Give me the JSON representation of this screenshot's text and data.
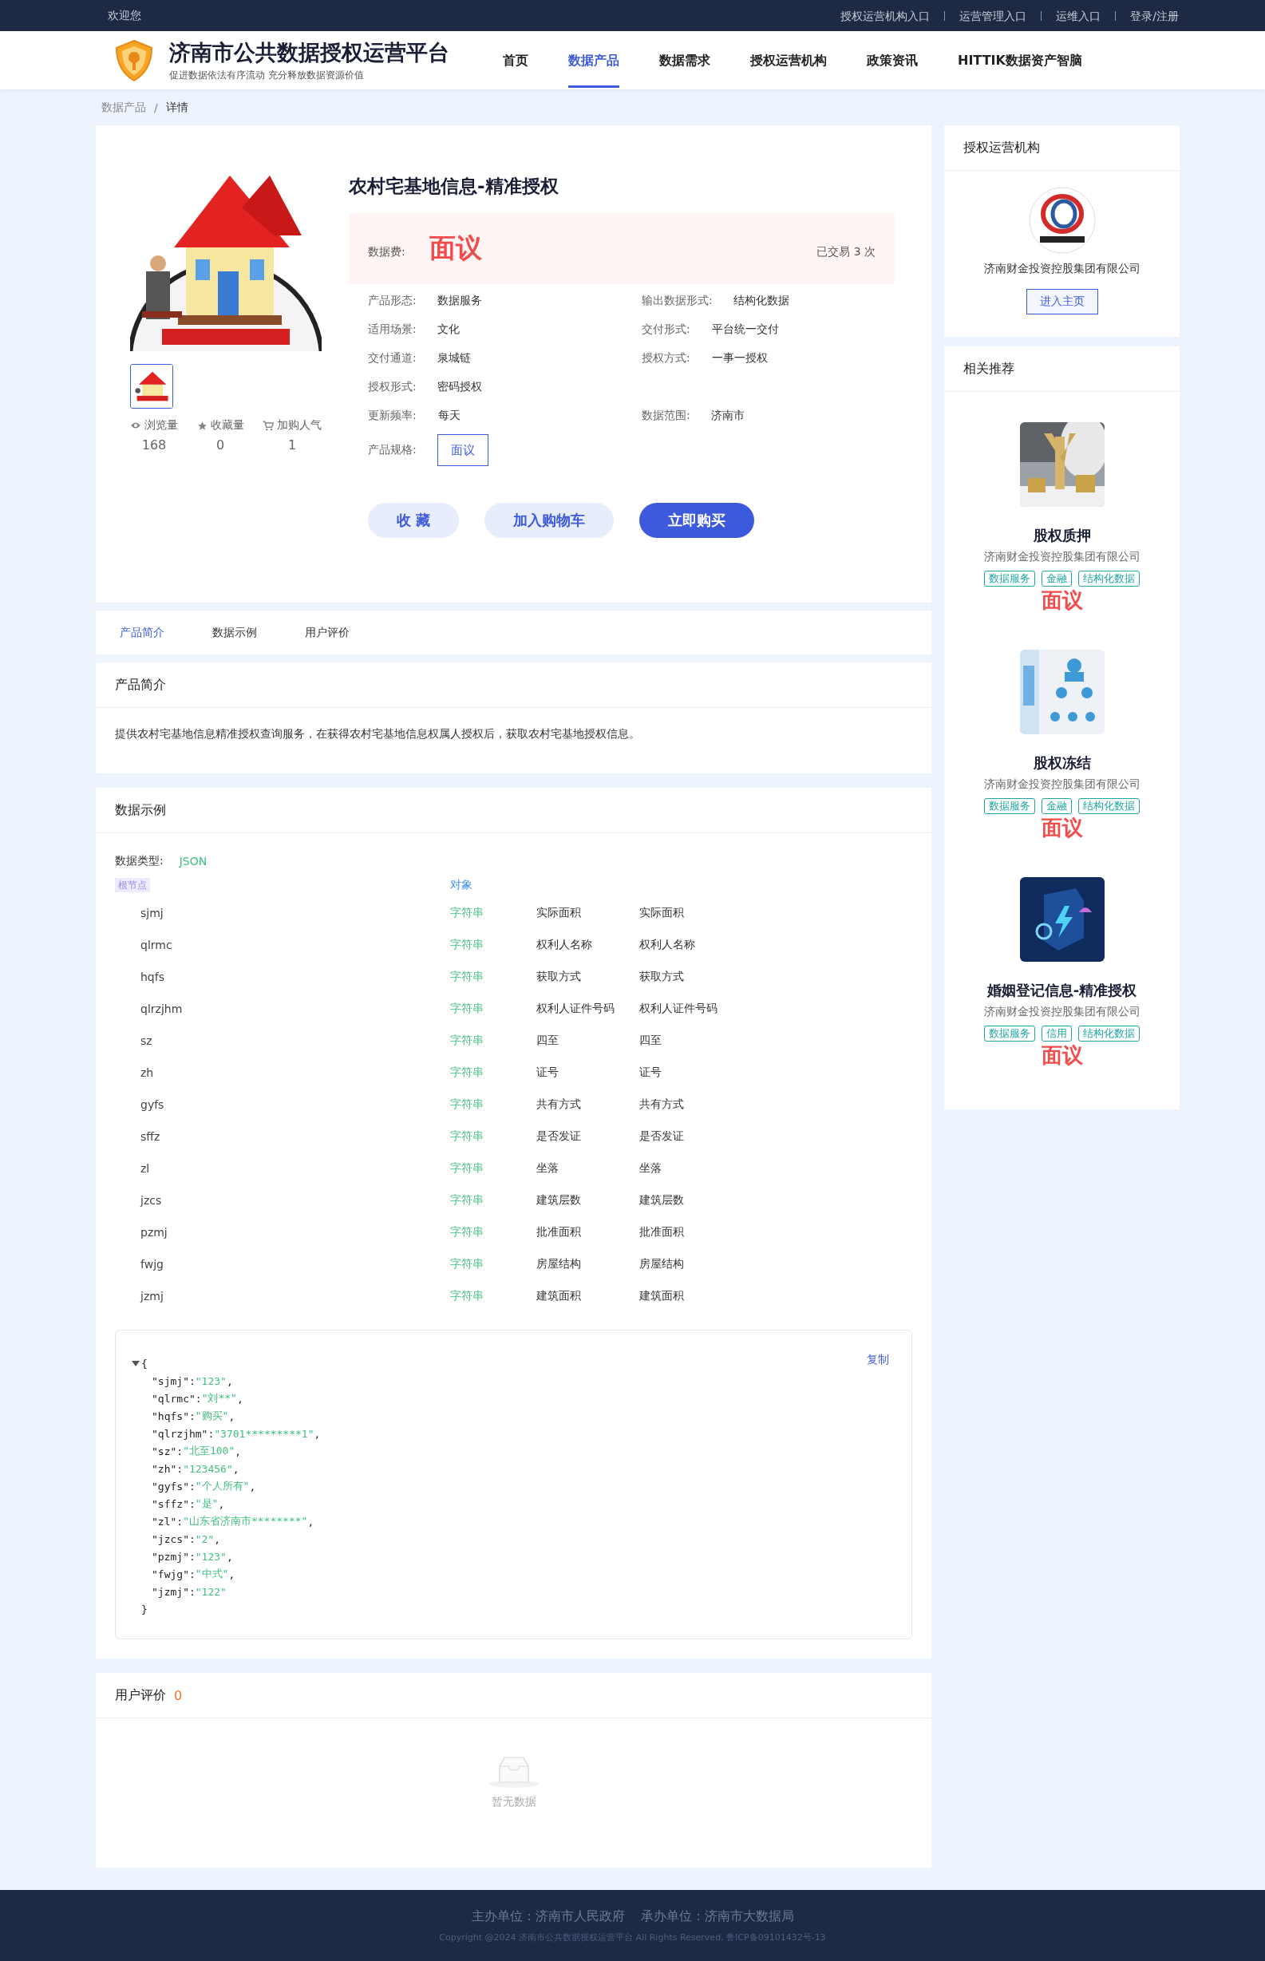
{
  "top_bar": {
    "welcome": "欢迎您",
    "links": [
      "授权运营机构入口",
      "运营管理入口",
      "运维入口",
      "登录/注册"
    ]
  },
  "header": {
    "site_title": "济南市公共数据授权运营平台",
    "slogan": "促进数据依法有序流动 充分释放数据资源价值",
    "nav": [
      {
        "label": "首页",
        "selected": false
      },
      {
        "label": "数据产品",
        "selected": true
      },
      {
        "label": "数据需求",
        "selected": false
      },
      {
        "label": "授权运营机构",
        "selected": false
      },
      {
        "label": "政策资讯",
        "selected": false
      },
      {
        "label": "HITTIK数据资产智脑",
        "selected": false
      }
    ]
  },
  "breadcrumb": [
    "数据产品",
    "/",
    "详情"
  ],
  "product": {
    "title": "农村宅基地信息-精准授权",
    "fee_label": "数据费:",
    "price": "面议",
    "trades": "已交易 3 次",
    "stats": [
      {
        "kind": "views",
        "label": "浏览量",
        "value": "168"
      },
      {
        "kind": "favorites",
        "label": "收藏量",
        "value": "0"
      },
      {
        "kind": "cart",
        "label": "加购人气",
        "value": "1"
      }
    ],
    "attributes": [
      {
        "label": "产品形态:",
        "value": "数据服务"
      },
      {
        "label": "输出数据形式:",
        "value": "结构化数据"
      },
      {
        "label": "适用场景:",
        "value": "文化"
      },
      {
        "label": "交付形式:",
        "value": "平台统一交付"
      },
      {
        "label": "交付通道:",
        "value": "泉城链"
      },
      {
        "label": "授权方式:",
        "value": "一事一授权"
      },
      {
        "label": "授权形式:",
        "value": "密码授权"
      },
      {
        "label": "更新频率:",
        "value": "每天"
      },
      {
        "label": "数据范围:",
        "value": "济南市"
      }
    ],
    "spec_label": "产品规格:",
    "spec": "面议",
    "buttons": [
      {
        "kind": "light",
        "label": "收 藏"
      },
      {
        "kind": "light",
        "label": "加入购物车"
      },
      {
        "kind": "primary",
        "label": "立即购买"
      }
    ]
  },
  "tabs": [
    {
      "label": "产品简介",
      "selected": true
    },
    {
      "label": "数据示例",
      "selected": false
    },
    {
      "label": "用户评价",
      "selected": false
    }
  ],
  "intro": {
    "title": "产品简介",
    "text": "提供农村宅基地信息精准授权查询服务，在获得农村宅基地信息权属人授权后，获取农村宅基地授权信息。"
  },
  "data_example": {
    "title": "数据示例",
    "type_label": "数据类型:",
    "type": "JSON",
    "root_tag": "根节点",
    "root_type": "对象",
    "fields": [
      {
        "name": "sjmj",
        "type": "字符串",
        "column_3": "实际面积",
        "column_4": "实际面积"
      },
      {
        "name": "qlrmc",
        "type": "字符串",
        "column_3": "权利人名称",
        "column_4": "权利人名称"
      },
      {
        "name": "hqfs",
        "type": "字符串",
        "column_3": "获取方式",
        "column_4": "获取方式"
      },
      {
        "name": "qlrzjhm",
        "type": "字符串",
        "column_3": "权利人证件号码",
        "column_4": "权利人证件号码"
      },
      {
        "name": "sz",
        "type": "字符串",
        "column_3": "四至",
        "column_4": "四至"
      },
      {
        "name": "zh",
        "type": "字符串",
        "column_3": "证号",
        "column_4": "证号"
      },
      {
        "name": "gyfs",
        "type": "字符串",
        "column_3": "共有方式",
        "column_4": "共有方式"
      },
      {
        "name": "sffz",
        "type": "字符串",
        "column_3": "是否发证",
        "column_4": "是否发证"
      },
      {
        "name": "zl",
        "type": "字符串",
        "column_3": "坐落",
        "column_4": "坐落"
      },
      {
        "name": "jzcs",
        "type": "字符串",
        "column_3": "建筑层数",
        "column_4": "建筑层数"
      },
      {
        "name": "pzmj",
        "type": "字符串",
        "column_3": "批准面积",
        "column_4": "批准面积"
      },
      {
        "name": "fwjg",
        "type": "字符串",
        "column_3": "房屋结构",
        "column_4": "房屋结构"
      },
      {
        "name": "jzmj",
        "type": "字符串",
        "column_3": "建筑面积",
        "column_4": "建筑面积"
      }
    ],
    "code": {
      "copy": "复制",
      "open": "{",
      "close": "}",
      "expanded": true,
      "lines": [
        {
          "key": "\"sjmj\":",
          "value": "\"123\"",
          "tail": ","
        },
        {
          "key": "\"qlrmc\":",
          "value": "\"刘**\"",
          "tail": ","
        },
        {
          "key": "\"hqfs\":",
          "value": "\"购买\"",
          "tail": ","
        },
        {
          "key": "\"qlrzjhm\":",
          "value": "\"3701*********1\"",
          "tail": ","
        },
        {
          "key": "\"sz\":",
          "value": "\"北至100\"",
          "tail": ","
        },
        {
          "key": "\"zh\":",
          "value": "\"123456\"",
          "tail": ","
        },
        {
          "key": "\"gyfs\":",
          "value": "\"个人所有\"",
          "tail": ","
        },
        {
          "key": "\"sffz\":",
          "value": "\"是\"",
          "tail": ","
        },
        {
          "key": "\"zl\":",
          "value": "\"山东省济南市********\"",
          "tail": ","
        },
        {
          "key": "\"jzcs\":",
          "value": "\"2\"",
          "tail": ","
        },
        {
          "key": "\"pzmj\":",
          "value": "\"123\"",
          "tail": ","
        },
        {
          "key": "\"fwjg\":",
          "value": "\"中式\"",
          "tail": ","
        },
        {
          "key": "\"jzmj\":",
          "value": "\"122\""
        }
      ]
    }
  },
  "reviews": {
    "title": "用户评价",
    "count": "0",
    "empty": "暂无数据"
  },
  "org": {
    "title": "授权运营机构",
    "name": "济南财金投资控股集团有限公司",
    "button": "进入主页"
  },
  "recommended": {
    "title": "相关推荐",
    "items": [
      {
        "kind": "coins",
        "name": "股权质押",
        "company": "济南财金投资控股集团有限公司",
        "tags": [
          "数据服务",
          "金融",
          "结构化数据"
        ],
        "price": "面议"
      },
      {
        "kind": "people",
        "name": "股权冻结",
        "company": "济南财金投资控股集团有限公司",
        "tags": [
          "数据服务",
          "金融",
          "结构化数据"
        ],
        "price": "面议"
      },
      {
        "kind": "shield",
        "name": "婚姻登记信息-精准授权",
        "company": "济南财金投资控股集团有限公司",
        "tags": [
          "数据服务",
          "信用",
          "结构化数据"
        ],
        "price": "面议"
      }
    ]
  },
  "footer": {
    "sponsors": [
      "主办单位：济南市人民政府",
      "承办单位：济南市大数据局"
    ],
    "copyright": "Copyright @2024 济南市公共数据授权运营平台 All Rights Reserved. 鲁ICP备09101432号-13"
  }
}
